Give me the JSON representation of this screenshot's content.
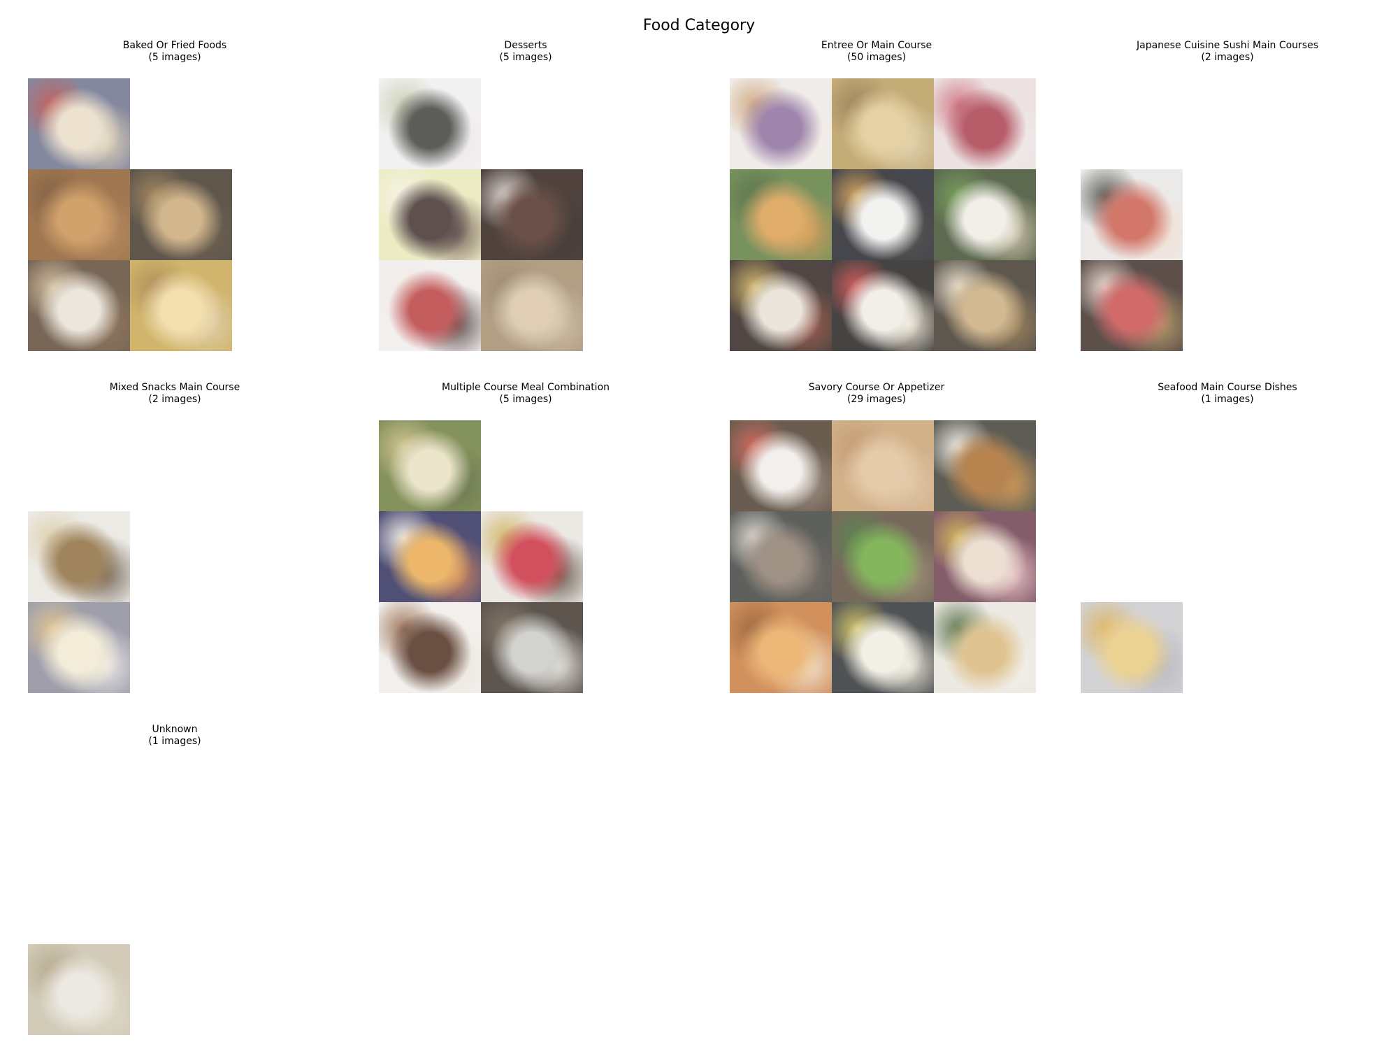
{
  "title": "Food Category",
  "panels": [
    {
      "name": "Baked Or Fried Foods",
      "count_label": "(5 images)",
      "tiles": [
        {
          "row": 0,
          "col": 0,
          "colors": [
            "#6a6e8a",
            "#e9dcc6",
            "#b8403a",
            "#d8c8a8"
          ]
        },
        {
          "row": 1,
          "col": 0,
          "colors": [
            "#8a5a2a",
            "#c98e4c",
            "#6b4220",
            "#a9733f"
          ]
        },
        {
          "row": 1,
          "col": 1,
          "colors": [
            "#3c3225",
            "#c9a774",
            "#8f6c3e",
            "#4f3f2c"
          ]
        },
        {
          "row": 2,
          "col": 0,
          "colors": [
            "#5b4632",
            "#e8e2d6",
            "#c9b089",
            "#7a5a3c"
          ]
        },
        {
          "row": 2,
          "col": 1,
          "colors": [
            "#c7a54c",
            "#efd89d",
            "#a1783a",
            "#d7c29a"
          ]
        }
      ]
    },
    {
      "name": "Desserts",
      "count_label": "(5 images)",
      "tiles": [
        {
          "row": 0,
          "col": 0,
          "colors": [
            "#f0eeee",
            "#3a3a36",
            "#c0c8a8",
            "#e8e4e8"
          ]
        },
        {
          "row": 1,
          "col": 0,
          "colors": [
            "#e8e8b8",
            "#3c2a28",
            "#f4f0e0",
            "#5a4038"
          ]
        },
        {
          "row": 1,
          "col": 1,
          "colors": [
            "#2a1a14",
            "#4a2a20",
            "#d8d0c8",
            "#1a120e"
          ]
        },
        {
          "row": 2,
          "col": 0,
          "colors": [
            "#f0ecec",
            "#b83a3a",
            "#efe8e0",
            "#3a2a28"
          ]
        },
        {
          "row": 2,
          "col": 1,
          "colors": [
            "#a08a6a",
            "#d8c4a4",
            "#8a7458",
            "#c4b092"
          ]
        }
      ]
    },
    {
      "name": "Entree Or Main Course",
      "count_label": "(50 images)",
      "tiles": [
        {
          "row": 0,
          "col": 0,
          "colors": [
            "#ece8e4",
            "#8a6a9a",
            "#c89a6a",
            "#f0e8e0"
          ]
        },
        {
          "row": 0,
          "col": 1,
          "colors": [
            "#b89a5a",
            "#e0c890",
            "#8a6a3a",
            "#d8c8a0"
          ]
        },
        {
          "row": 0,
          "col": 2,
          "colors": [
            "#e8dcdc",
            "#a83a4a",
            "#c86070",
            "#f0e8e8"
          ]
        },
        {
          "row": 1,
          "col": 0,
          "colors": [
            "#5a7a3a",
            "#d89a4a",
            "#3a5a2a",
            "#c8883a"
          ]
        },
        {
          "row": 1,
          "col": 1,
          "colors": [
            "#1e1e26",
            "#f0f0ee",
            "#c8903a",
            "#30302c"
          ]
        },
        {
          "row": 1,
          "col": 2,
          "colors": [
            "#3a4a2a",
            "#f0ece4",
            "#5a8a3a",
            "#c8b89a"
          ]
        },
        {
          "row": 2,
          "col": 0,
          "colors": [
            "#2a1e1a",
            "#e8e0d4",
            "#c8a84a",
            "#8a3a2a"
          ]
        },
        {
          "row": 2,
          "col": 1,
          "colors": [
            "#1e1a1a",
            "#f0ece4",
            "#c83a3a",
            "#e8e0c8"
          ]
        },
        {
          "row": 2,
          "col": 2,
          "colors": [
            "#3a3228",
            "#c8aa7a",
            "#e8dcc4",
            "#8a6a3a"
          ]
        }
      ]
    },
    {
      "name": "Japanese Cuisine Sushi Main Courses",
      "count_label": "(2 images)",
      "tiles": [
        {
          "row": 1,
          "col": 0,
          "colors": [
            "#e8e6e4",
            "#c85a4a",
            "#3a3a34",
            "#f0d8c8"
          ]
        },
        {
          "row": 2,
          "col": 0,
          "colors": [
            "#3a2a24",
            "#c84a4a",
            "#e8d4c8",
            "#a88a4a"
          ]
        }
      ]
    },
    {
      "name": "Mixed Snacks Main Course",
      "count_label": "(2 images)",
      "tiles": [
        {
          "row": 1,
          "col": 0,
          "colors": [
            "#e8e6e0",
            "#8a6a3a",
            "#d8c8a0",
            "#5a4a3a"
          ]
        },
        {
          "row": 2,
          "col": 0,
          "colors": [
            "#8a8a9a",
            "#f0e8d0",
            "#d8b87a",
            "#e8e4e0"
          ]
        }
      ]
    },
    {
      "name": "Multiple Course Meal Combination",
      "count_label": "(5 images)",
      "tiles": [
        {
          "row": 0,
          "col": 0,
          "colors": [
            "#6a7a3a",
            "#e8e0c0",
            "#c8b87a",
            "#4a5a2a"
          ]
        },
        {
          "row": 1,
          "col": 0,
          "colors": [
            "#2a2a5a",
            "#e8a84a",
            "#f0ece4",
            "#c86a3a"
          ]
        },
        {
          "row": 1,
          "col": 1,
          "colors": [
            "#e8e4e0",
            "#c82a3a",
            "#c8a84a",
            "#4a3a2a"
          ]
        },
        {
          "row": 2,
          "col": 0,
          "colors": [
            "#f0ece8",
            "#4a2a1a",
            "#8a5a3a",
            "#e8e0d4"
          ]
        },
        {
          "row": 2,
          "col": 1,
          "colors": [
            "#3a3028",
            "#c8c8c4",
            "#6a5a48",
            "#e0dcd4"
          ]
        }
      ]
    },
    {
      "name": "Savory Course Or Appetizer",
      "count_label": "(29 images)",
      "tiles": [
        {
          "row": 0,
          "col": 0,
          "colors": [
            "#4a3a2a",
            "#f0ece8",
            "#c84a3a",
            "#8a7a6a"
          ]
        },
        {
          "row": 0,
          "col": 1,
          "colors": [
            "#c8a070",
            "#e0c098",
            "#b88858",
            "#d8b890"
          ]
        },
        {
          "row": 0,
          "col": 2,
          "colors": [
            "#3a3a30",
            "#a86a2a",
            "#f0ece4",
            "#c8883a"
          ]
        },
        {
          "row": 1,
          "col": 0,
          "colors": [
            "#3a3e3a",
            "#8a7a6a",
            "#d8d0c8",
            "#5a4e44"
          ]
        },
        {
          "row": 1,
          "col": 1,
          "colors": [
            "#5a4a3a",
            "#6aa83a",
            "#3a6a2a",
            "#8a7a5a"
          ]
        },
        {
          "row": 1,
          "col": 2,
          "colors": [
            "#6a3a4a",
            "#e8d8c8",
            "#c8a83a",
            "#e0b0b8"
          ]
        },
        {
          "row": 2,
          "col": 0,
          "colors": [
            "#c8783a",
            "#e8a85a",
            "#8a4a1a",
            "#f0e0c8"
          ]
        },
        {
          "row": 2,
          "col": 1,
          "colors": [
            "#2a2e30",
            "#f0ece0",
            "#c8b84a",
            "#e8e0d0"
          ]
        },
        {
          "row": 2,
          "col": 2,
          "colors": [
            "#e8e4dc",
            "#d8b87a",
            "#3a5a2a",
            "#f0ece4"
          ]
        }
      ]
    },
    {
      "name": "Seafood Main Course Dishes",
      "count_label": "(1 images)",
      "tiles": [
        {
          "row": 2,
          "col": 0,
          "colors": [
            "#c8c8cc",
            "#e8c87a",
            "#d8a84a",
            "#a8a8b0"
          ]
        }
      ]
    },
    {
      "name": "Unknown",
      "count_label": "(1 images)",
      "tiles": [
        {
          "row": 2,
          "col": 0,
          "colors": [
            "#c8c0a8",
            "#e8e4dc",
            "#a89878",
            "#d8d0bc"
          ]
        }
      ]
    }
  ]
}
